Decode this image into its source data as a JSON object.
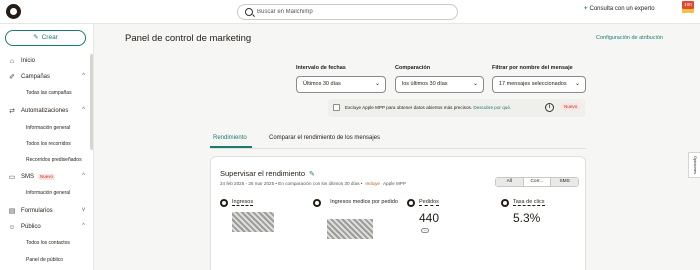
{
  "topbar": {
    "search_placeholder": "Buscar en Mailchimp",
    "expert_label": "Consulta con un experto",
    "plus_icon": "+",
    "badge": "100"
  },
  "sidebar": {
    "create_label": "Crear",
    "items": [
      {
        "label": "Inicio",
        "icon": "home-icon",
        "glyph": "⌂"
      },
      {
        "label": "Campañas",
        "icon": "megaphone-icon",
        "glyph": "✐",
        "chevron": "^"
      },
      {
        "label": "Automatizaciones",
        "icon": "automation-icon",
        "glyph": "⇄",
        "chevron": "^"
      },
      {
        "label": "SMS",
        "icon": "sms-icon",
        "glyph": "▭",
        "badge": "Nuevo",
        "chevron": "^"
      },
      {
        "label": "Formularios",
        "icon": "form-icon",
        "glyph": "▤",
        "chevron": "v"
      },
      {
        "label": "Público",
        "icon": "audience-icon",
        "glyph": "☺",
        "chevron": "^"
      }
    ],
    "subitems": {
      "campaigns": [
        "Todas las campañas"
      ],
      "automations": [
        "Información general",
        "Todos los recorridos",
        "Recorridos prediseñados"
      ],
      "sms": [
        "Información general"
      ],
      "audience": [
        "Todos los contactos",
        "Panel de público"
      ]
    }
  },
  "main": {
    "title": "Panel de control de marketing",
    "attribution_link": "Configuración de atribución",
    "filters": [
      {
        "label": "Intervalo de fechas",
        "value": "Últimos 30 días"
      },
      {
        "label": "Comparación",
        "value": "los últimos 30 días"
      },
      {
        "label": "Filtrar por nombre del mensaje",
        "value": "17 mensajes seleccionados"
      }
    ],
    "notice": {
      "text": "Excluye Apple MPP para obtener datos abiertos más precisos.",
      "link": "Descubre por qué.",
      "info": "i",
      "badge": "Nuevo"
    },
    "tabs": [
      "Rendimiento",
      "Comparar el rendimiento de los mensajes"
    ],
    "card": {
      "title": "Supervisar el rendimiento",
      "date_range": "24 feb 2025 - 25 mar 2025 • En comparación con los últimos 30 días •",
      "includes": "Incluye",
      "apple": "Apple MPP",
      "segments": [
        "All",
        "Corr...",
        "SMS"
      ],
      "metrics": [
        {
          "label": "Ingresos",
          "value": ""
        },
        {
          "label": "Ingresos medios por pedido",
          "value": ""
        },
        {
          "label": "Pedidos",
          "value": "440"
        },
        {
          "label": "Tasa de clics",
          "value": "5.3%"
        }
      ],
      "trend_pill": "—"
    }
  },
  "side_tab": "Opiniones"
}
